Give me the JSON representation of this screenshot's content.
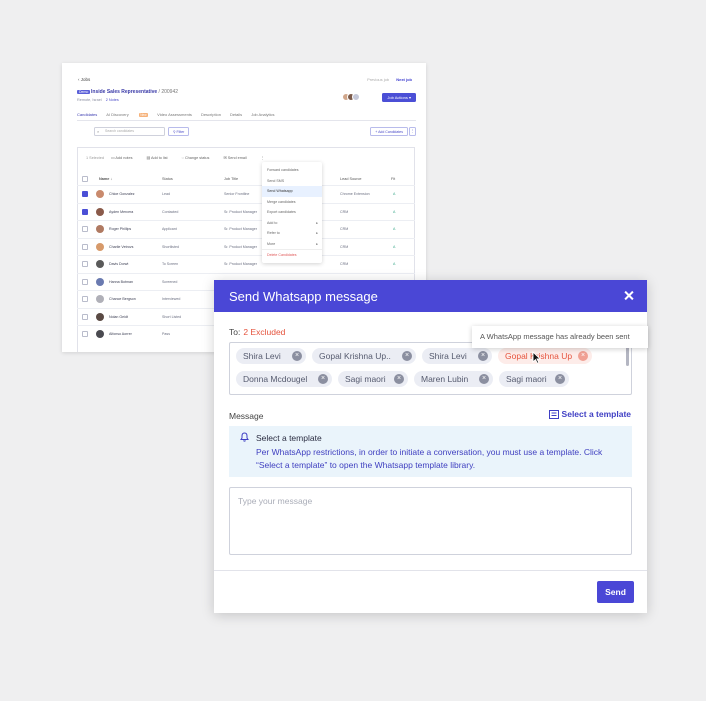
{
  "bg": {
    "back_label": "Jobs",
    "pager": {
      "prev": "Previous job",
      "next": "Next job"
    },
    "job": {
      "tag": "Demo",
      "title": "Inside Sales Representative",
      "id": "/ 200942",
      "location": "Remote, Israel",
      "notes": "2 Notes"
    },
    "job_actions": "Job Actions",
    "tabs": [
      "Candidates",
      "AI Discovery",
      "Video Assessments",
      "Description",
      "Details",
      "Job Analytics"
    ],
    "ai_badge": "New",
    "search_placeholder": "Search candidates",
    "filter_label": "Filter",
    "add_candidates": "+ Add Candidates",
    "more_label": "⋮",
    "toolbar": {
      "selected": "1 Selected",
      "add_note": "Add notes",
      "add_list": "Add to list",
      "change_status": "Change status",
      "send_email": "Send email",
      "more": "⋮"
    },
    "columns": {
      "name": "Name",
      "status": "Status",
      "job_title": "Job Title",
      "lead_source": "Lead Source",
      "fit": "Fit"
    },
    "rows": [
      {
        "name": "Chloe Gonzalez",
        "status": "Lead",
        "job_title": "Senior Frontline",
        "lead_source": "Chrome Extension",
        "fit": "A",
        "checked": true,
        "color": "#c98a6d"
      },
      {
        "name": "Ayden Mercera",
        "status": "Contacted",
        "job_title": "Sr. Product Manager",
        "lead_source": "CRM",
        "fit": "A",
        "checked": true,
        "color": "#8a5a4a"
      },
      {
        "name": "Roger Phillips",
        "status": "Applicant",
        "job_title": "Sr. Product Manager",
        "lead_source": "CRM",
        "fit": "A",
        "checked": false,
        "color": "#b07a62"
      },
      {
        "name": "Charlie Vetrovs",
        "status": "Shortlisted",
        "job_title": "Sr. Product Manager",
        "lead_source": "CRM",
        "fit": "A",
        "checked": false,
        "color": "#d79a6a"
      },
      {
        "name": "Davis Dorwt",
        "status": "To Screen",
        "job_title": "Sr. Product Manager",
        "lead_source": "CRM",
        "fit": "A",
        "checked": false,
        "color": "#5a5a5a"
      },
      {
        "name": "Hanna Botman",
        "status": "Screened",
        "job_title": "",
        "lead_source": "",
        "fit": "",
        "checked": false,
        "color": "#6a7ab0"
      },
      {
        "name": "Chance Bergson",
        "status": "Interviewed",
        "job_title": "",
        "lead_source": "",
        "fit": "",
        "checked": false,
        "color": "#b0b0b8"
      },
      {
        "name": "Nolan Geidt",
        "status": "Short Listed",
        "job_title": "",
        "lead_source": "",
        "fit": "",
        "checked": false,
        "color": "#5a4a44"
      },
      {
        "name": "Alfonso Aorrer",
        "status": "Pass",
        "job_title": "",
        "lead_source": "",
        "fit": "",
        "checked": false,
        "color": "#4a4a50"
      }
    ],
    "menu": [
      {
        "label": "Forward candidates",
        "arrow": ""
      },
      {
        "label": "Send SMS",
        "arrow": ""
      },
      {
        "label": "Send Whatsapp",
        "arrow": "",
        "highlight": true
      },
      {
        "label": "Merge candidates",
        "arrow": ""
      },
      {
        "label": "Export candidates",
        "arrow": ""
      },
      {
        "label": "Add to",
        "arrow": "▸"
      },
      {
        "label": "Refer to",
        "arrow": "▸"
      },
      {
        "label": "More",
        "arrow": "▸"
      },
      {
        "label": "Delete Candidates",
        "arrow": "",
        "danger": true
      }
    ]
  },
  "modal": {
    "title": "Send Whatsapp message",
    "to_label": "To:",
    "excluded": "2 Excluded",
    "tooltip": "A WhatsApp message has already been sent",
    "recipients": [
      {
        "name": "Shira Levi",
        "warn": false
      },
      {
        "name": "Gopal Krishna Up..",
        "warn": false
      },
      {
        "name": "Shira Levi",
        "warn": false
      },
      {
        "name": "Gopal Krishna Up",
        "warn": true
      },
      {
        "name": "Donna Mcdougel",
        "warn": false
      },
      {
        "name": "Sagi maori",
        "warn": false
      },
      {
        "name": "Maren Lubin",
        "warn": false
      },
      {
        "name": "Sagi maori",
        "warn": false
      }
    ],
    "message_label": "Message",
    "select_template": "Select a template",
    "notice_title": "Select a template",
    "notice_body": "Per WhatsApp restrictions, in order to initiate a conversation, you must use a template. Click “Select a template” to open the Whatsapp template library.",
    "message_placeholder": "Type your message",
    "send_label": "Send"
  },
  "colors": {
    "accent": "#4a47d6",
    "warn": "#e5533d",
    "notice_bg": "#eaf4fb"
  }
}
